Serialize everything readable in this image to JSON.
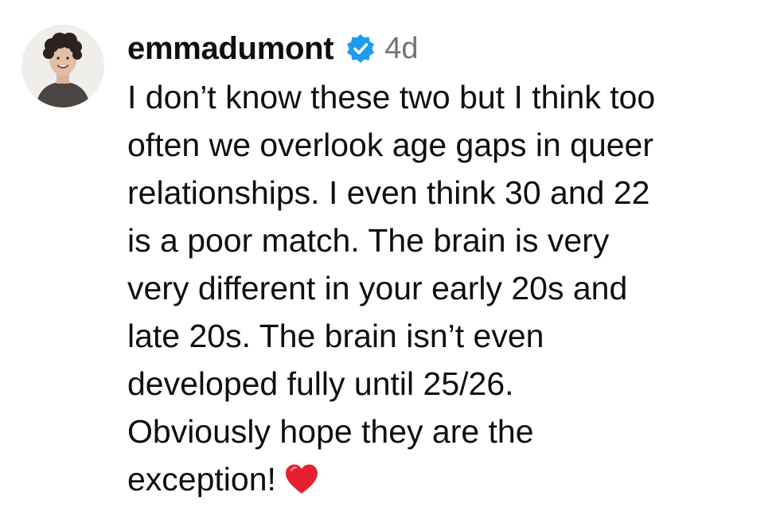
{
  "comment": {
    "username": "emmadumont",
    "verified_icon": "verified-badge-icon",
    "verified_color": "#1d9bf0",
    "timestamp": "4d",
    "text_lines": [
      "I don’t know these two but I think too",
      "often we overlook age gaps in queer",
      "relationships. I even think 30 and 22",
      "is a poor match. The brain is very",
      "very different in your early 20s and",
      "late 20s. The brain isn’t even",
      "developed fully until 25/26.",
      "Obviously hope they are the",
      "exception!"
    ],
    "emoji_icon": "red-heart-icon"
  }
}
